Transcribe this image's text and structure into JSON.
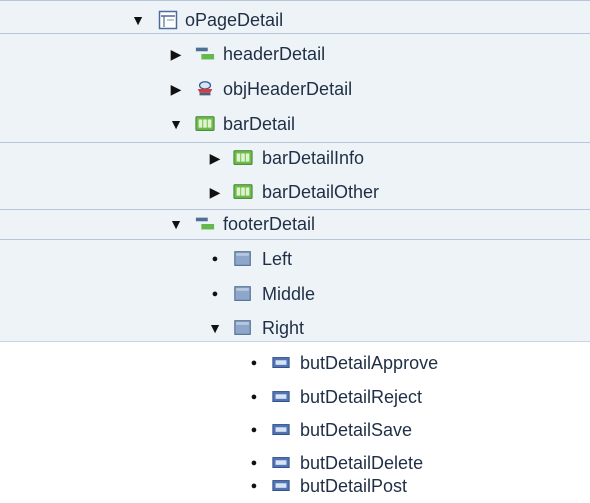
{
  "tree": {
    "nodes": [
      {
        "label": "oPageDetail",
        "icon": "page-icon",
        "state": "expanded"
      },
      {
        "label": "headerDetail",
        "icon": "header-icon",
        "state": "collapsed"
      },
      {
        "label": "objHeaderDetail",
        "icon": "object-header-icon",
        "state": "collapsed"
      },
      {
        "label": "barDetail",
        "icon": "bar-icon",
        "state": "expanded"
      },
      {
        "label": "barDetailInfo",
        "icon": "bar-icon",
        "state": "collapsed"
      },
      {
        "label": "barDetailOther",
        "icon": "bar-icon",
        "state": "collapsed"
      },
      {
        "label": "footerDetail",
        "icon": "footer-icon",
        "state": "expanded"
      },
      {
        "label": "Left",
        "icon": "panel-icon",
        "state": "leaf"
      },
      {
        "label": "Middle",
        "icon": "panel-icon",
        "state": "leaf"
      },
      {
        "label": "Right",
        "icon": "panel-icon",
        "state": "expanded"
      },
      {
        "label": "butDetailApprove",
        "icon": "button-icon",
        "state": "leaf"
      },
      {
        "label": "butDetailReject",
        "icon": "button-icon",
        "state": "leaf"
      },
      {
        "label": "butDetailSave",
        "icon": "button-icon",
        "state": "leaf"
      },
      {
        "label": "butDetailDelete",
        "icon": "button-icon",
        "state": "leaf"
      },
      {
        "label": "butDetailPost",
        "icon": "button-icon",
        "state": "leaf"
      }
    ]
  }
}
